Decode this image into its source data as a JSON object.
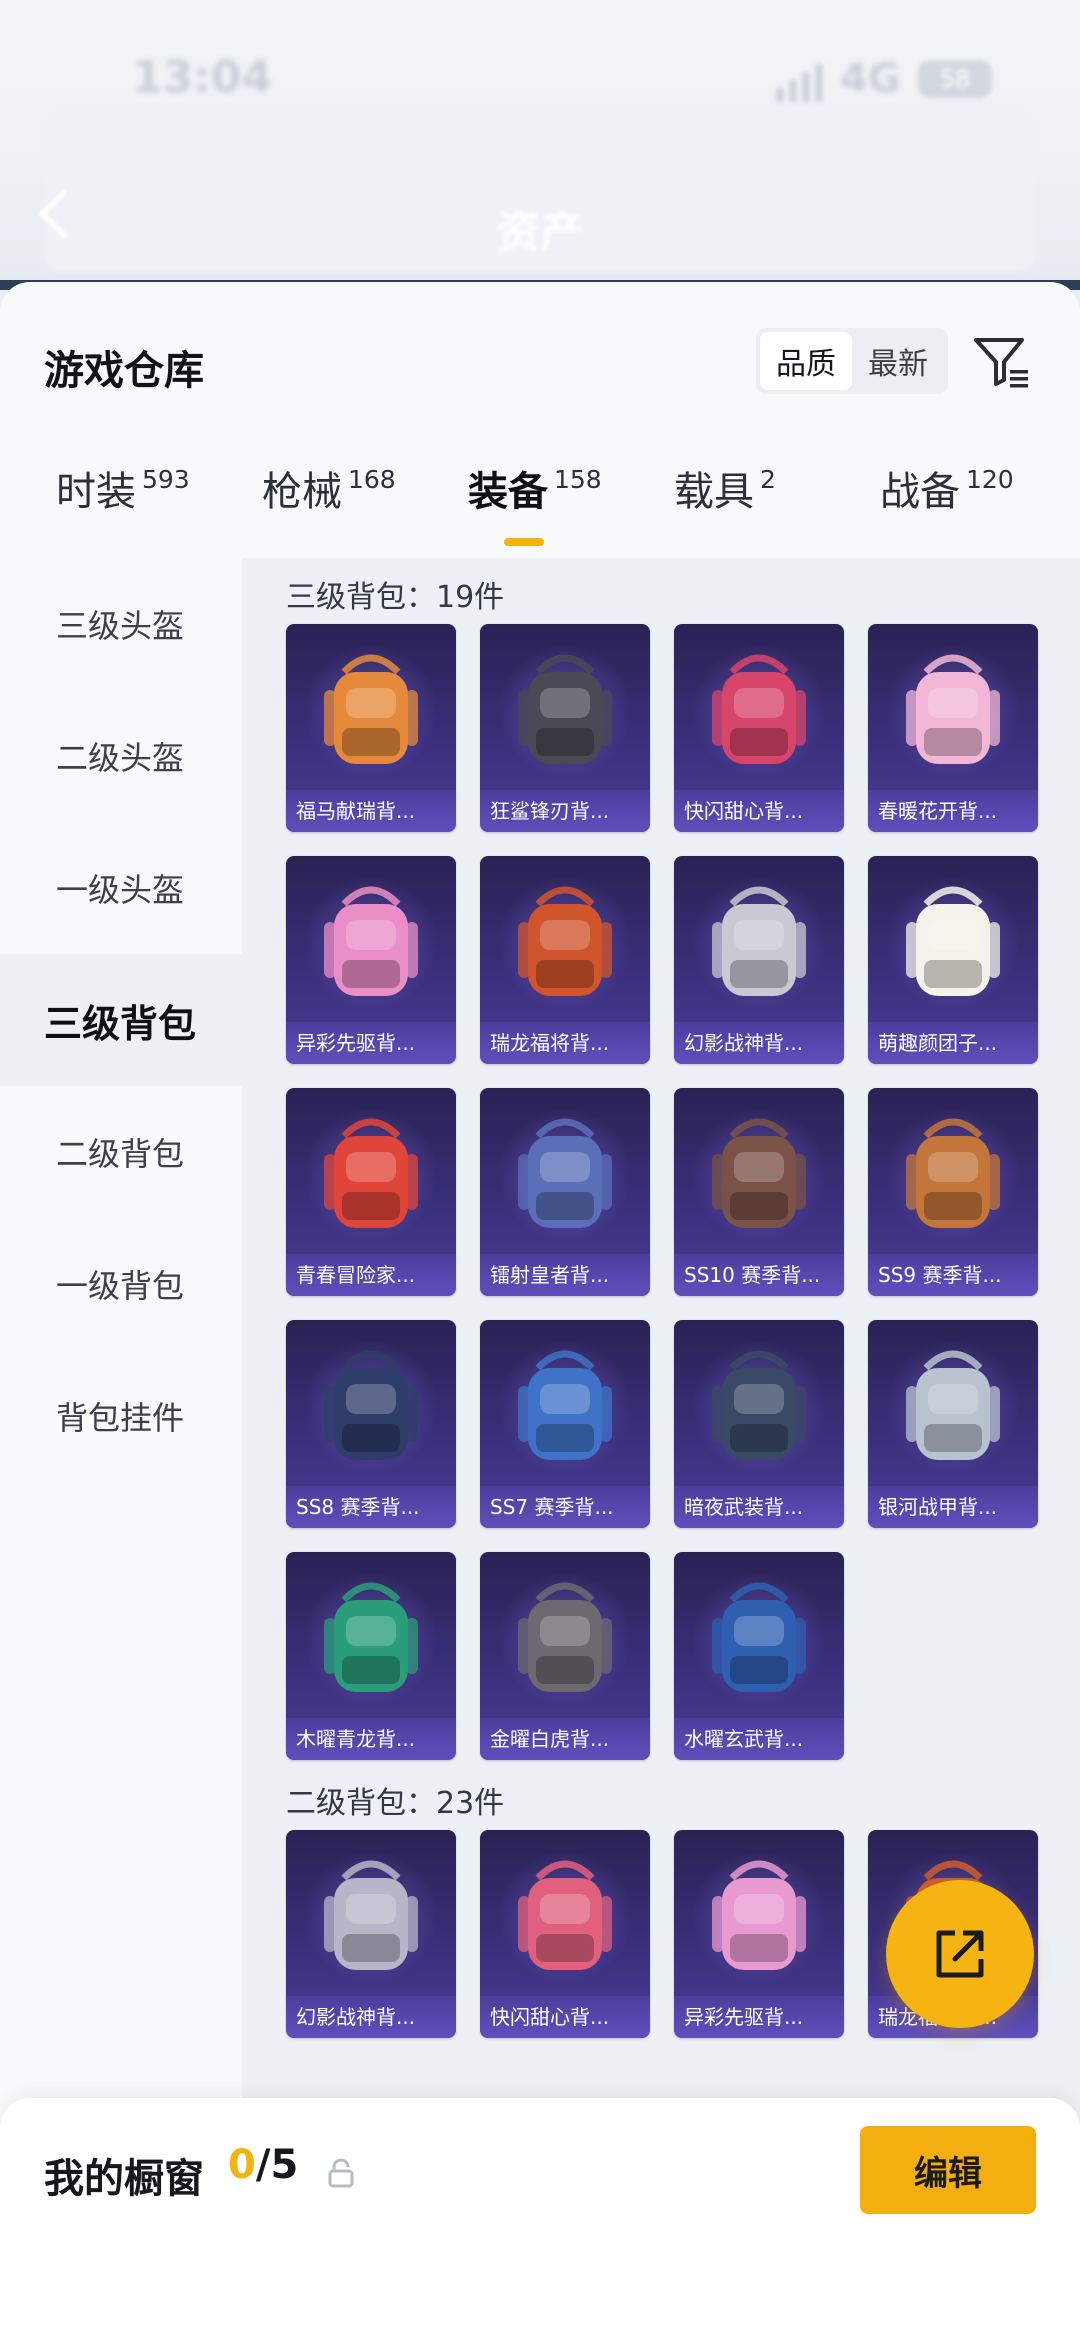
{
  "status_bar": {
    "time": "13:04",
    "network": "4G",
    "battery": "58"
  },
  "header": {
    "title": "资产"
  },
  "warehouse": {
    "title": "游戏仓库",
    "sort_options": [
      "品质",
      "最新"
    ],
    "sort_selected": "品质"
  },
  "categories": [
    {
      "label": "时装",
      "count": "593"
    },
    {
      "label": "枪械",
      "count": "168"
    },
    {
      "label": "装备",
      "count": "158"
    },
    {
      "label": "载具",
      "count": "2"
    },
    {
      "label": "战备",
      "count": "120"
    }
  ],
  "active_category": "装备",
  "sidebar": {
    "items": [
      "三级头盔",
      "二级头盔",
      "一级头盔",
      "三级背包",
      "二级背包",
      "一级背包",
      "背包挂件"
    ],
    "active": "三级背包"
  },
  "sections": [
    {
      "heading": "三级背包：19件",
      "items": [
        {
          "name": "福马献瑞背...",
          "icon": "rabbit-backpack",
          "color": "#e58a3a"
        },
        {
          "name": "狂鲨锋刃背...",
          "icon": "shark-backpack",
          "color": "#4a4a55"
        },
        {
          "name": "快闪甜心背...",
          "icon": "heart-backpack",
          "color": "#d8456a"
        },
        {
          "name": "春暖花开背...",
          "icon": "butterfly-backpack",
          "color": "#f2b7d6"
        },
        {
          "name": "异彩先驱背...",
          "icon": "colorful-backpack",
          "color": "#e98ec6"
        },
        {
          "name": "瑞龙福将背...",
          "icon": "dragon-backpack",
          "color": "#d0552c"
        },
        {
          "name": "幻影战神背...",
          "icon": "phantom-backpack",
          "color": "#c9c9d4"
        },
        {
          "name": "萌趣颜团子...",
          "icon": "dumpling-backpack",
          "color": "#f3f3ea"
        },
        {
          "name": "青春冒险家...",
          "icon": "dino-backpack",
          "color": "#e0453a"
        },
        {
          "name": "镭射皇者背...",
          "icon": "laser-backpack",
          "color": "#5a6fb8"
        },
        {
          "name": "SS10 赛季背...",
          "icon": "season10-backpack",
          "color": "#7a5248"
        },
        {
          "name": "SS9 赛季背...",
          "icon": "season9-backpack",
          "color": "#c3753a"
        },
        {
          "name": "SS8 赛季背...",
          "icon": "season8-backpack",
          "color": "#2f3d6a"
        },
        {
          "name": "SS7 赛季背...",
          "icon": "season7-backpack",
          "color": "#3f73c8"
        },
        {
          "name": "暗夜武装背...",
          "icon": "night-armor-backpack",
          "color": "#3a4a66"
        },
        {
          "name": "银河战甲背...",
          "icon": "galaxy-armor-backpack",
          "color": "#b9c2cf"
        },
        {
          "name": "木曜青龙背...",
          "icon": "azure-dragon-backpack",
          "color": "#2a9d7a"
        },
        {
          "name": "金曜白虎背...",
          "icon": "white-tiger-backpack",
          "color": "#6c6a70"
        },
        {
          "name": "水曜玄武背...",
          "icon": "black-tortoise-backpack",
          "color": "#2f5fb0"
        }
      ]
    },
    {
      "heading": "二级背包：23件",
      "items": [
        {
          "name": "幻影战神背...",
          "icon": "phantom-backpack",
          "color": "#b9b5c8"
        },
        {
          "name": "快闪甜心背...",
          "icon": "heart-backpack",
          "color": "#e0607e"
        },
        {
          "name": "异彩先驱背...",
          "icon": "colorful-backpack",
          "color": "#e89ad0"
        },
        {
          "name": "瑞龙福将背...",
          "icon": "dragon-backpack",
          "color": "#cf5a2e"
        }
      ]
    }
  ],
  "bottom": {
    "showcase_label": "我的橱窗",
    "showcase_current": "0",
    "showcase_total": "/5",
    "edit_label": "编辑"
  },
  "colors": {
    "accent": "#f5ae10",
    "card_bg": "#3a2f7a"
  }
}
